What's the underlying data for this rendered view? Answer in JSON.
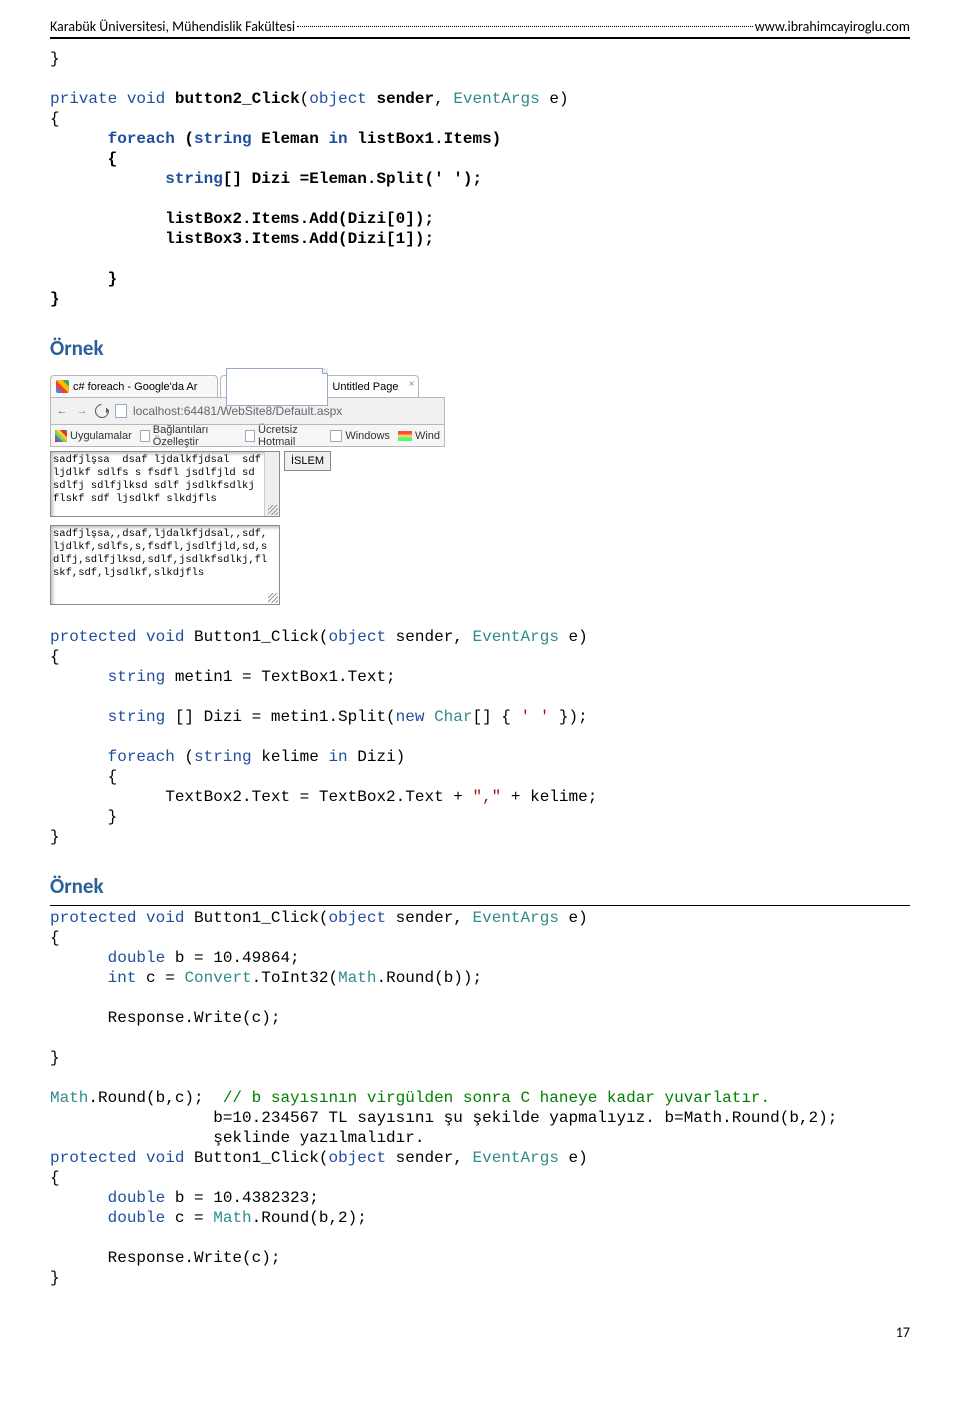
{
  "header": {
    "left": "Karabük Üniversitesi, Mühendislik Fakültesi",
    "right": "www.ibrahimcayiroglu.com"
  },
  "code1": {
    "l1": "}",
    "l2a": "private",
    "l2b": "void",
    "l2c": "button2_Click",
    "l2d": "(",
    "l2e": "object",
    "l2f": "sender",
    "l2g": ", ",
    "l2h": "EventArgs",
    "l2i": " e)",
    "l3": "{",
    "l4a": "      foreach",
    "l4b": " (",
    "l4c": "string",
    "l4d": " Eleman ",
    "l4e": "in",
    "l4f": " listBox1.Items)",
    "l5": "      {",
    "l6a": "            string",
    "l6b": "[] Dizi =Eleman.Split(' ');",
    "l7": "            listBox2.Items.Add(Dizi[0]);",
    "l8": "            listBox3.Items.Add(Dizi[1]);",
    "l9": "      }",
    "l10": "}"
  },
  "ornek1": "Örnek",
  "browser": {
    "tab1": "c# foreach - Google'da Ar",
    "tab2": "Untitled Page",
    "url": "localhost:64481/WebSite8/Default.aspx",
    "bm_apps": "Uygulamalar",
    "bm_bag": "Bağlantıları Özelleştir",
    "bm_hotmail": "Ücretsiz Hotmail",
    "bm_windows": "Windows",
    "bm_wind": "Wind",
    "textarea1": "sadfjlşsa  dsaf ljdalkfjdsal  sdf\nljdlkf sdlfs s fsdfl jsdlfjld sd\nsdlfj sdlfjlksd sdlf jsdlkfsdlkj\nflskf sdf ljsdlkf slkdjfls",
    "button": "İSLEM",
    "textarea2": "sadfjlşsa,,dsaf,ljdalkfjdsal,,sdf,\nljdlkf,sdlfs,s,fsdfl,jsdlfjld,sd,s\ndlfj,sdlfjlksd,sdlf,jsdlkfsdlkj,fl\nskf,sdf,ljsdlkf,slkdjfls"
  },
  "code2": {
    "l1a": "protected",
    "l1b": " void",
    "l1c": " Button1_Click(",
    "l1d": "object",
    "l1e": " sender, ",
    "l1f": "EventArgs",
    "l1g": " e)",
    "l2": "{",
    "l3a": "      string",
    "l3b": " metin1 = TextBox1.Text;",
    "l4a": "      string",
    "l4b": " [] Dizi = metin1.Split(",
    "l4c": "new",
    "l4d": " Char",
    "l4e": "[] { ",
    "l4f": "' '",
    "l4g": " });",
    "l5a": "      foreach",
    "l5b": " (",
    "l5c": "string",
    "l5d": " kelime ",
    "l5e": "in",
    "l5f": " Dizi)",
    "l6": "      {",
    "l7a": "            TextBox2.Text = TextBox2.Text + ",
    "l7b": "\",\"",
    "l7c": " + kelime;",
    "l8": "      }",
    "l9": "}"
  },
  "ornek2": "Örnek",
  "code3": {
    "l1a": "protected",
    "l1b": " void",
    "l1c": " Button1_Click(",
    "l1d": "object",
    "l1e": " sender, ",
    "l1f": "EventArgs",
    "l1g": " e)",
    "l2": "{",
    "l3a": "      double",
    "l3b": " b = 10.49864;",
    "l4a": "      int",
    "l4b": " c = ",
    "l4c": "Convert",
    "l4d": ".ToInt32(",
    "l4e": "Math",
    "l4f": ".Round(b));",
    "l5": "      Response.Write(c);",
    "l6": "}",
    "l7a": "Math",
    "l7b": ".Round(b,c);  ",
    "l7c": "// b sayısının virgülden sonra C haneye kadar yuvarlatır.",
    "l8": "                 b=10.234567 TL sayısını şu şekilde yapmalıyız. b=Math.Round(b,2);",
    "l9": "                 şeklinde yazılmalıdır.",
    "l10a": "protected",
    "l10b": " void",
    "l10c": " Button1_Click(",
    "l10d": "object",
    "l10e": " sender, ",
    "l10f": "EventArgs",
    "l10g": " e)",
    "l11": "{",
    "l12a": "      double",
    "l12b": " b = 10.4382323;",
    "l13a": "      double",
    "l13b": " c = ",
    "l13c": "Math",
    "l13d": ".Round(b,2);",
    "l14": "      Response.Write(c);",
    "l15": "}"
  },
  "pagenum": "17"
}
